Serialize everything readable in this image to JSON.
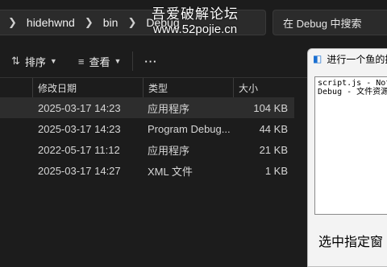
{
  "address": {
    "segments": [
      "hidehwnd",
      "bin",
      "Debug"
    ]
  },
  "watermark": {
    "line1": "吾爱破解论坛",
    "line2": "www.52pojie.cn"
  },
  "search": {
    "placeholder": "在 Debug 中搜索"
  },
  "toolbar": {
    "sort_label": "排序",
    "view_label": "查看",
    "more_label": "···"
  },
  "columns": [
    "修改日期",
    "类型",
    "大小"
  ],
  "rows": [
    {
      "date": "2025-03-17 14:23",
      "type": "应用程序",
      "size": "104 KB",
      "selected": true
    },
    {
      "date": "2025-03-17 14:23",
      "type": "Program Debug...",
      "size": "44 KB"
    },
    {
      "date": "2022-05-17 11:12",
      "type": "应用程序",
      "size": "21 KB"
    },
    {
      "date": "2025-03-17 14:27",
      "type": "XML 文件",
      "size": "1 KB"
    }
  ],
  "popup": {
    "title": "进行一个鱼的摸",
    "list_items": [
      "script.js - Note",
      "Debug - 文件资源"
    ],
    "footer": "选中指定窗"
  },
  "colors": {
    "background": "#1c1c1c",
    "selected_row": "#2d2d2d",
    "popup_bg": "#f3f3f3"
  }
}
